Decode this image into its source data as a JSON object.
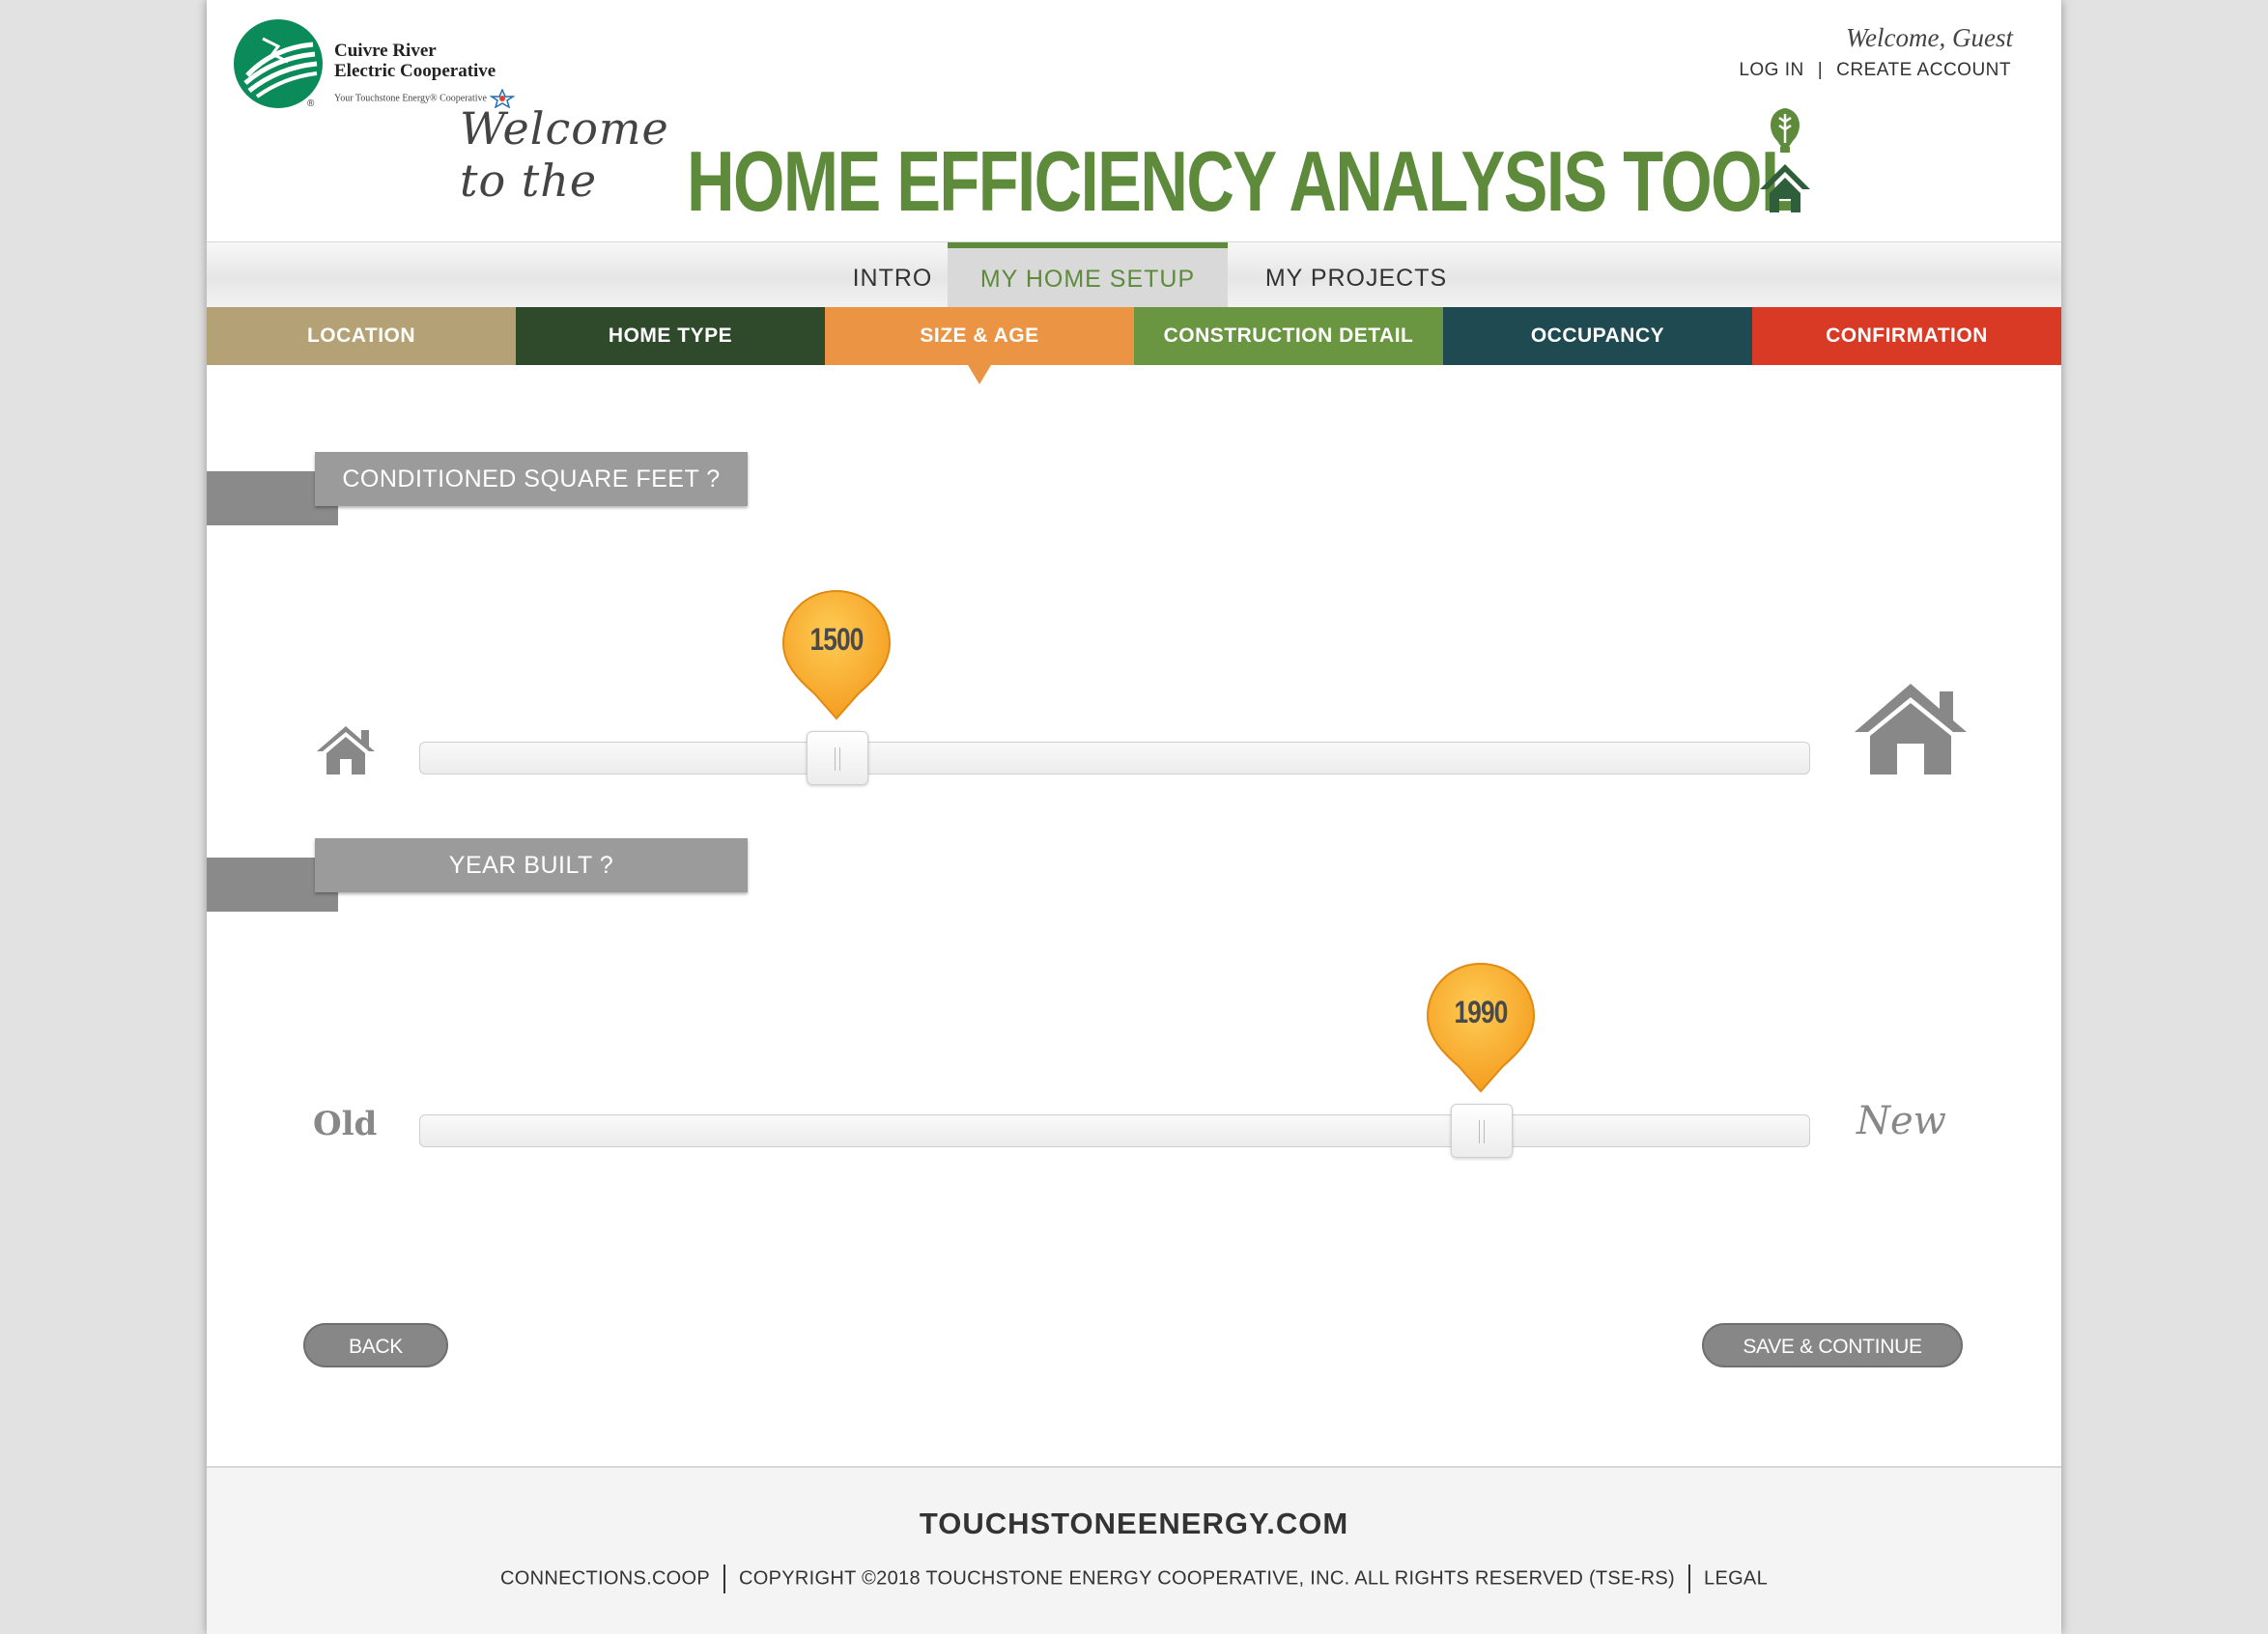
{
  "brand": {
    "name_line1": "Cuivre River",
    "name_line2": "Electric Cooperative",
    "tagline": "Your Touchstone Energy® Cooperative",
    "reg_mark": "®",
    "green": "#0b8a5a"
  },
  "account": {
    "welcome": "Welcome, Guest",
    "login": "LOG IN",
    "separator": "|",
    "create": "CREATE ACCOUNT"
  },
  "title": {
    "welcome": "Welcome to the",
    "main": "HOME EFFICIENCY ANALYSIS TOOL",
    "color": "#5d8b3b"
  },
  "main_nav": [
    {
      "label": "INTRO",
      "active": false
    },
    {
      "label": "MY HOME SETUP",
      "active": true
    },
    {
      "label": "MY PROJECTS",
      "active": false
    }
  ],
  "steps": [
    {
      "label": "LOCATION",
      "color": "#b4a276"
    },
    {
      "label": "HOME TYPE",
      "color": "#2f4a2b"
    },
    {
      "label": "SIZE & AGE",
      "color": "#eb9444",
      "active": true
    },
    {
      "label": "CONSTRUCTION DETAIL",
      "color": "#6a9541"
    },
    {
      "label": "OCCUPANCY",
      "color": "#1f4a52"
    },
    {
      "label": "CONFIRMATION",
      "color": "#d93a25"
    }
  ],
  "square_feet": {
    "label": "CONDITIONED SQUARE FEET ?",
    "value": "1500",
    "position_fraction": 0.3
  },
  "year_built": {
    "label": "YEAR BUILT ?",
    "value": "1990",
    "position_fraction": 0.763,
    "min_label": "Old",
    "max_label": "New"
  },
  "pin_color": "#f3a22c",
  "buttons": {
    "back": "BACK",
    "save": "SAVE & CONTINUE"
  },
  "footer": {
    "brand": "TOUCHSTONEENERGY.COM",
    "link1": "CONNECTIONS.COOP",
    "copyright": "COPYRIGHT ©2018 TOUCHSTONE ENERGY COOPERATIVE, INC. ALL RIGHTS RESERVED (TSE-RS)",
    "legal": "LEGAL"
  }
}
